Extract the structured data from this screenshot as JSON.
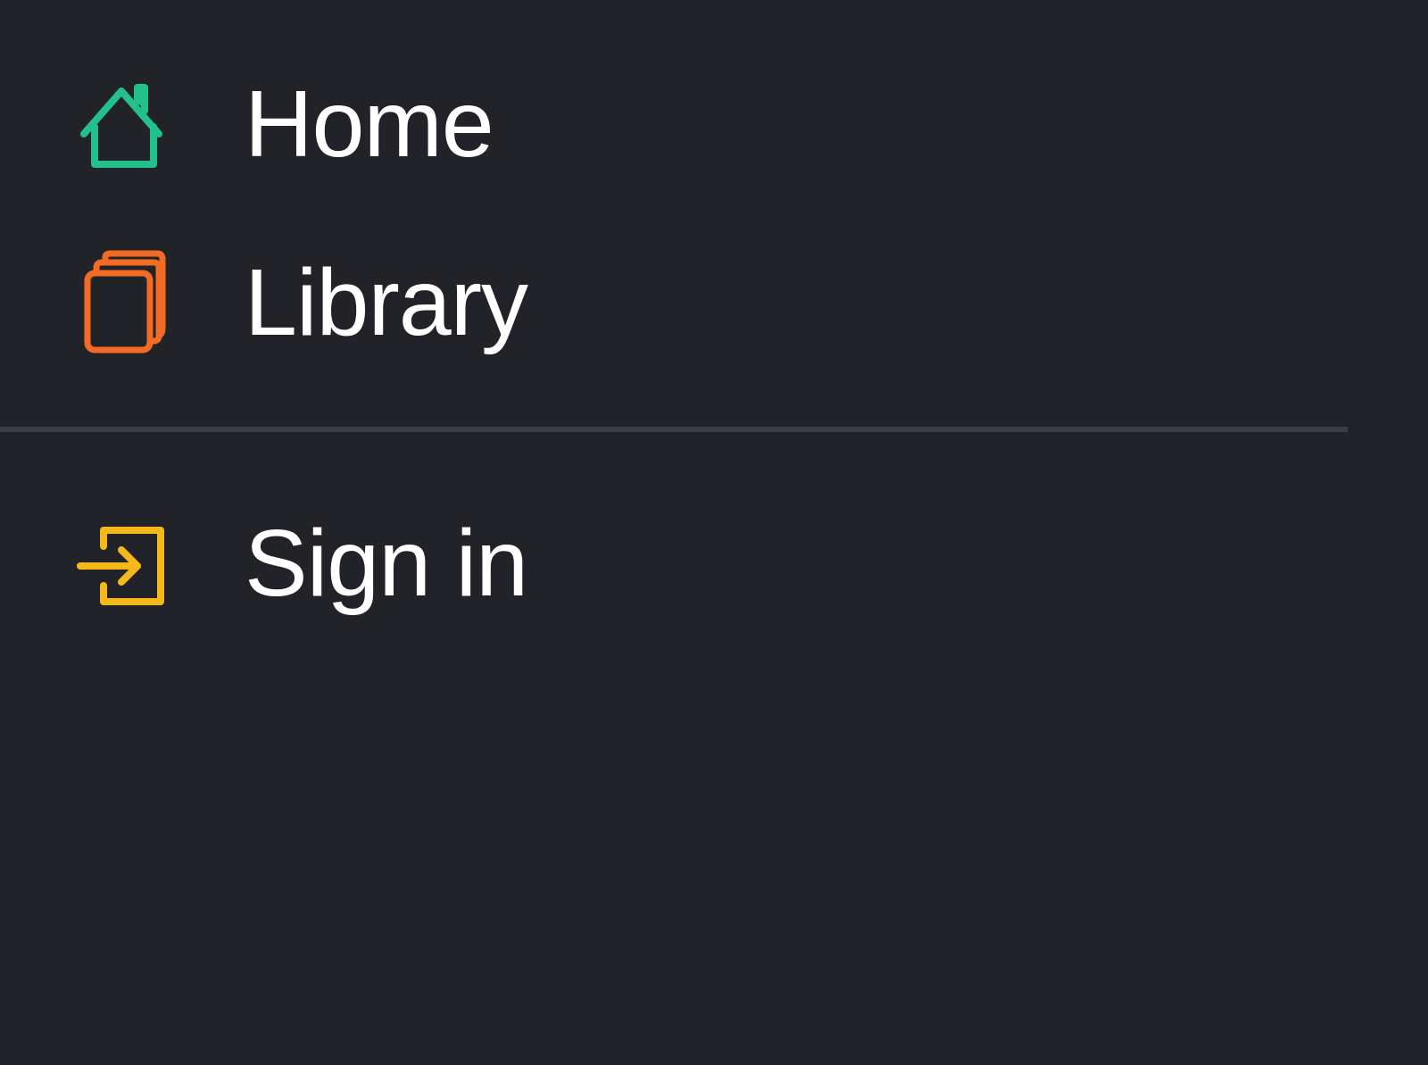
{
  "menu": {
    "items": [
      {
        "label": "Home",
        "icon": "home-icon",
        "color": "#22c08a"
      },
      {
        "label": "Library",
        "icon": "library-icon",
        "color": "#f36a25"
      }
    ],
    "secondary_items": [
      {
        "label": "Sign in",
        "icon": "sign-in-icon",
        "color": "#f5b81a"
      }
    ]
  },
  "theme": {
    "background": "#212328",
    "text": "#ffffff",
    "divider": "#3b3d43"
  }
}
